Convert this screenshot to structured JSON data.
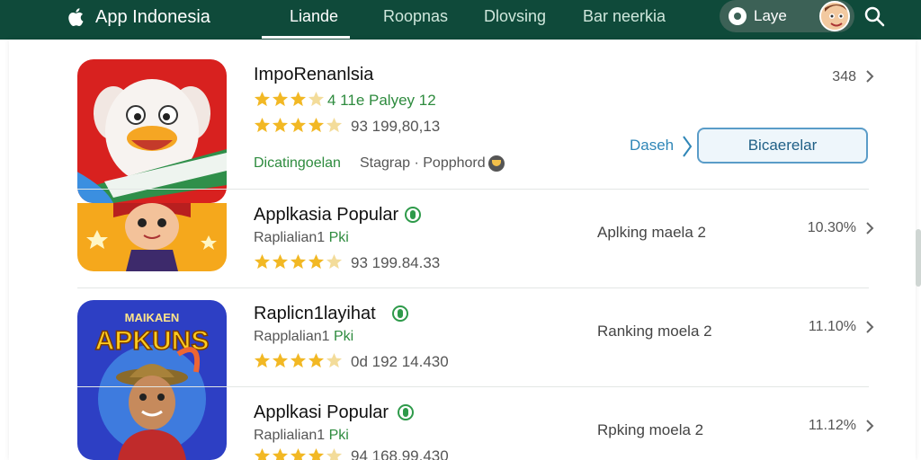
{
  "header": {
    "brand": "App Indonesia",
    "tabs": [
      {
        "label": "Liande"
      },
      {
        "label": "Roopnas"
      },
      {
        "label": "Dlovsing"
      },
      {
        "label": "Bar neerkia"
      }
    ],
    "search_pill_label": "Laye"
  },
  "apps": [
    {
      "title": "ImpoRenanlsia",
      "rating_line": "4  11e  Palyey 12",
      "stats": "93   199,80,13",
      "developer": "Dicatingoelan",
      "tags": "Stagrap · Popphord",
      "count": "348",
      "link": "Daseh",
      "button": "Bicaerelar"
    },
    {
      "title": "Applkasia Popular",
      "subtitle_prefix": "Raplialian1",
      "subtitle_suffix": "Pki",
      "stats": "93   199.84.33",
      "rank": "Aplking maela 2",
      "percent": "10.30%"
    },
    {
      "title": "Raplicn1layihat",
      "subtitle_prefix": "Rapplalian1",
      "subtitle_suffix": "Pki",
      "stats": "0d   192 14.430",
      "rank": "Ranking moela 2",
      "percent": "11.10%"
    },
    {
      "title": "Applkasi Popular",
      "subtitle_prefix": "Raplialian1",
      "subtitle_suffix": "Pki",
      "stats": "94   168.99.430",
      "rank": "Rpking moela 2",
      "percent": "11.12%"
    }
  ],
  "colors": {
    "header_bg": "#0f4a3a",
    "star": "#f2b824",
    "accent_green": "#2e8b3e",
    "link_blue": "#2f86b7"
  }
}
